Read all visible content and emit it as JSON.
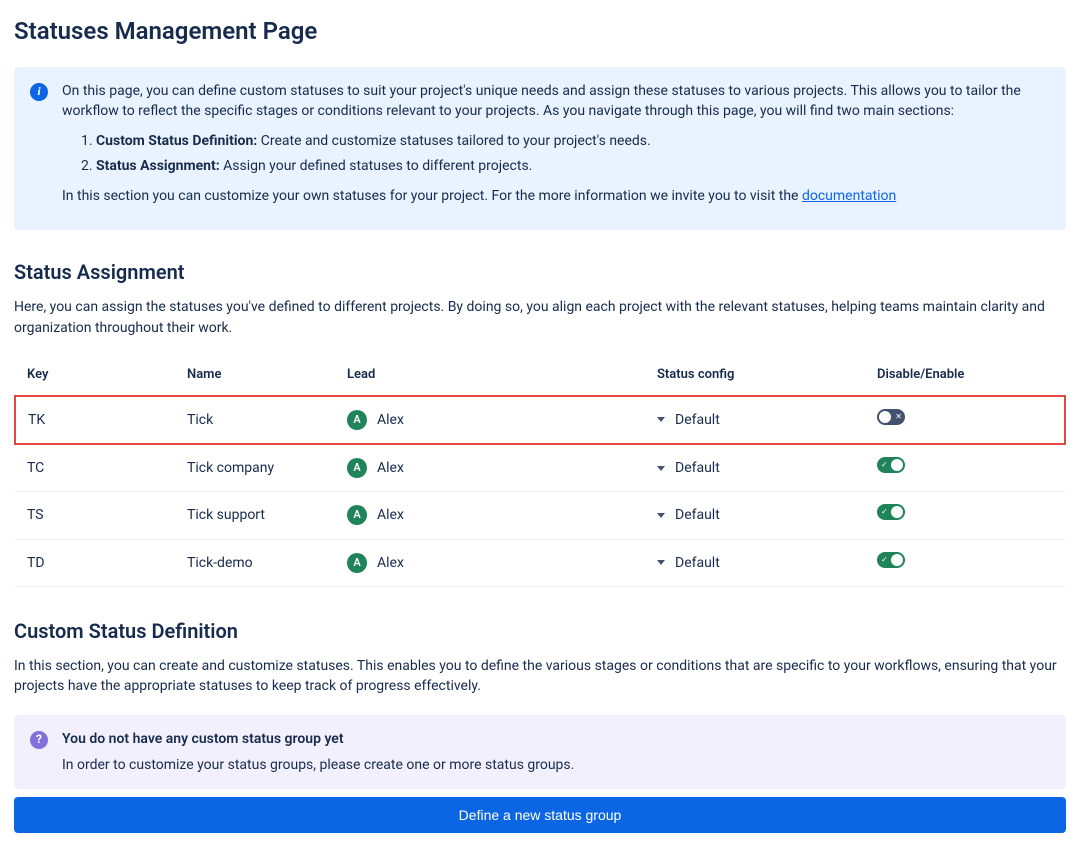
{
  "page_title": "Statuses Management Page",
  "info": {
    "intro": "On this page, you can define custom statuses to suit your project's unique needs and assign these statuses to various projects. This allows you to tailor the workflow to reflect the specific stages or conditions relevant to your projects. As you navigate through this page, you will find two main sections:",
    "bullets": [
      {
        "title": "Custom Status Definition:",
        "text": " Create and customize statuses tailored to your project's needs."
      },
      {
        "title": "Status Assignment:",
        "text": " Assign your defined statuses to different projects."
      }
    ],
    "outro_prefix": "In this section you can customize your own statuses for your project. For the more information we invite you to visit the ",
    "doc_link": "documentation"
  },
  "assignment": {
    "heading": "Status Assignment",
    "description": "Here, you can assign the statuses you've defined to different projects. By doing so, you align each project with the relevant statuses, helping teams maintain clarity and organization throughout their work.",
    "columns": {
      "key": "Key",
      "name": "Name",
      "lead": "Lead",
      "status": "Status config",
      "toggle": "Disable/Enable"
    },
    "rows": [
      {
        "key": "TK",
        "name": "Tick",
        "lead_initial": "A",
        "lead_name": "Alex",
        "status": "Default",
        "enabled": false,
        "highlight": true
      },
      {
        "key": "TC",
        "name": "Tick company",
        "lead_initial": "A",
        "lead_name": "Alex",
        "status": "Default",
        "enabled": true,
        "highlight": false
      },
      {
        "key": "TS",
        "name": "Tick support",
        "lead_initial": "A",
        "lead_name": "Alex",
        "status": "Default",
        "enabled": true,
        "highlight": false
      },
      {
        "key": "TD",
        "name": "Tick-demo",
        "lead_initial": "A",
        "lead_name": "Alex",
        "status": "Default",
        "enabled": true,
        "highlight": false
      }
    ]
  },
  "definition": {
    "heading": "Custom Status Definition",
    "description": "In this section, you can create and customize statuses. This enables you to define the various stages or conditions that are specific to your workflows, ensuring that your projects have the appropriate statuses to keep track of progress effectively.",
    "empty_title": "You do not have any custom status group yet",
    "empty_sub": "In order to customize your status groups, please create one or more status groups.",
    "button": "Define a new status group"
  }
}
